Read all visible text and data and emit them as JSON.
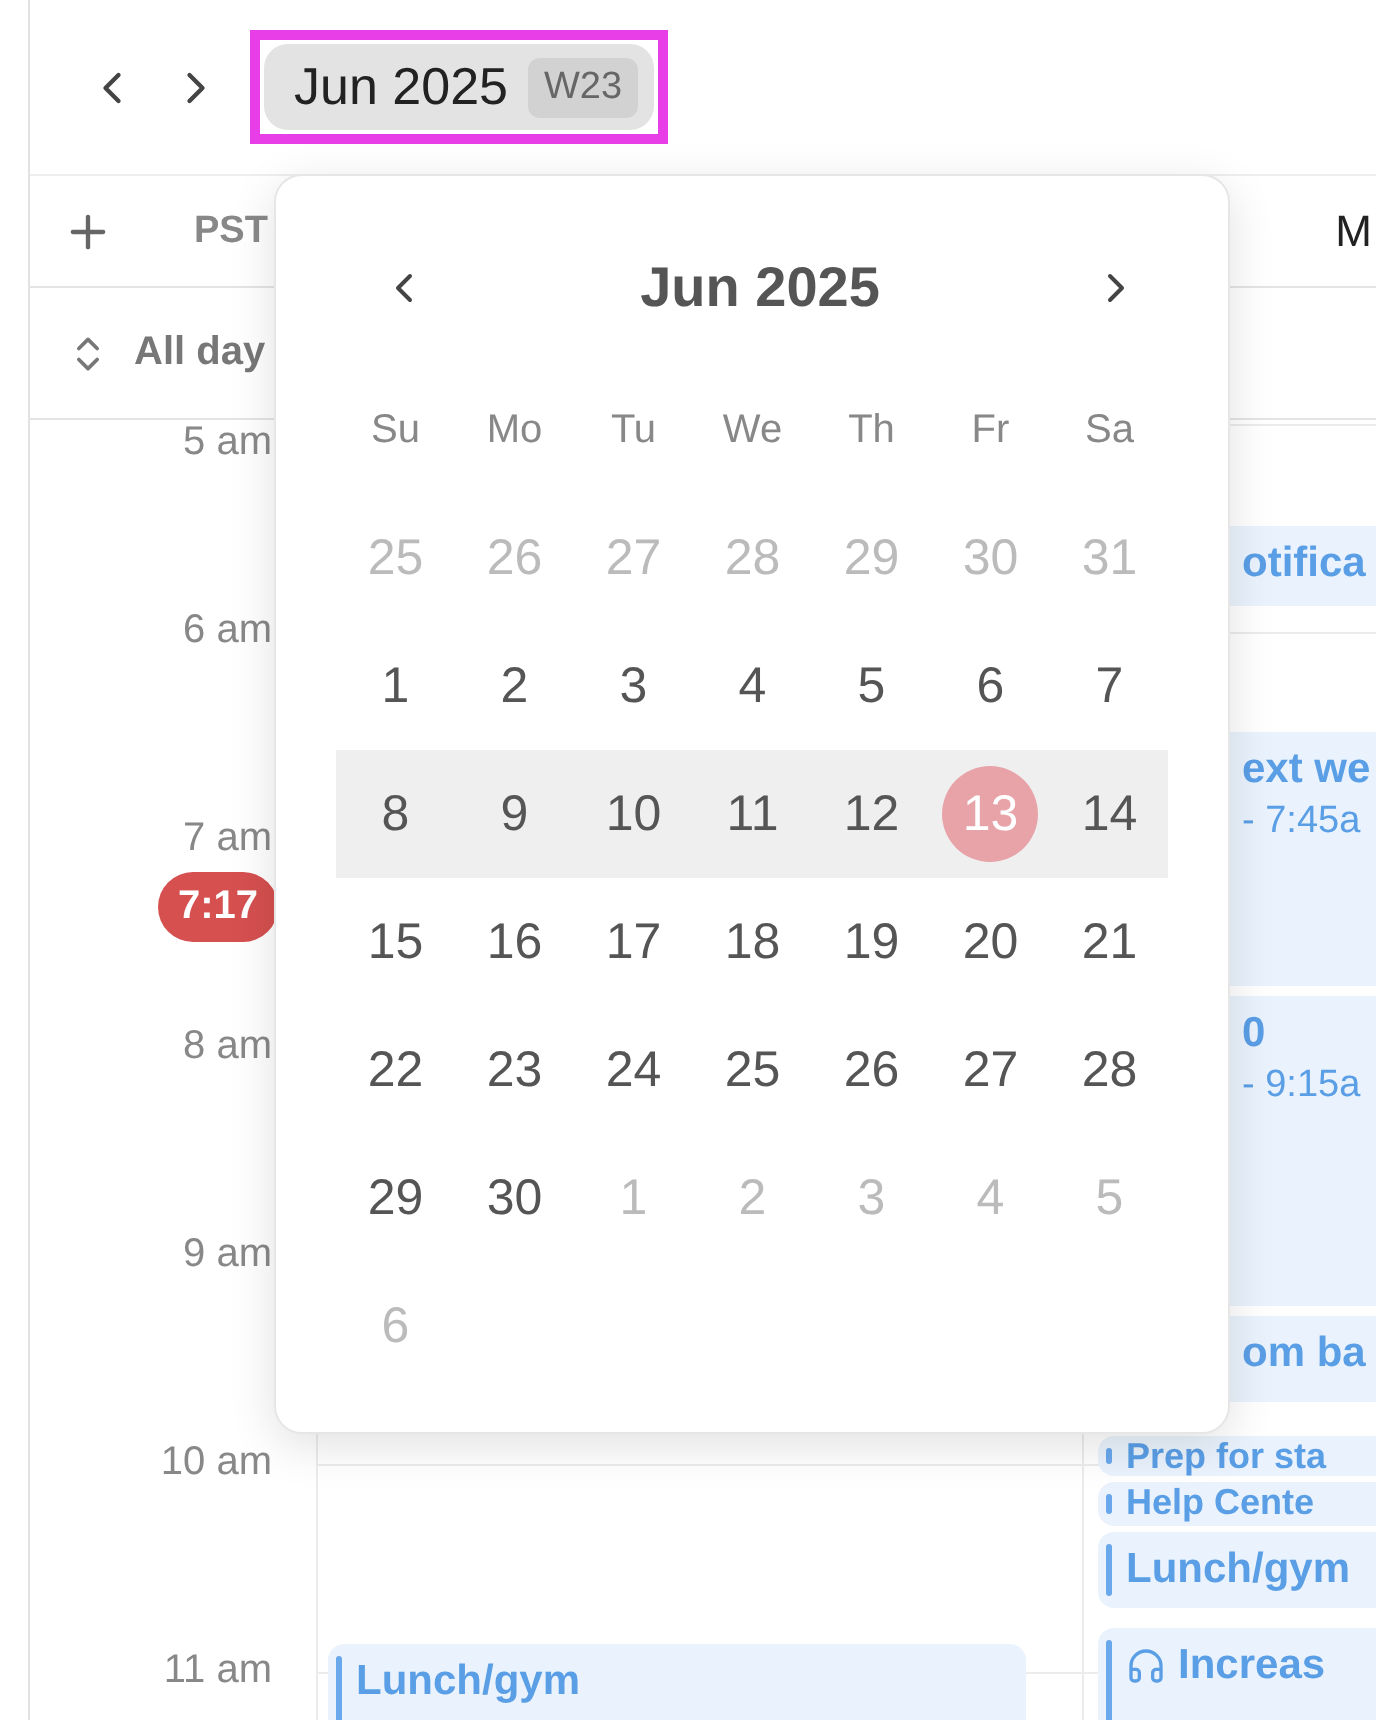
{
  "toolbar": {
    "month_button": {
      "label": "Jun 2025",
      "week_badge": "W23",
      "highlighted": true
    }
  },
  "header": {
    "timezone": "PST",
    "day_label": "M",
    "all_day": "All day"
  },
  "hours": [
    "5 am",
    "6 am",
    "7 am",
    "8 am",
    "9 am",
    "10 am",
    "11 am"
  ],
  "now_badge": "7:17",
  "events": [
    {
      "lines": [
        "Lunch/gym"
      ],
      "kind": "plain"
    },
    {
      "lines": [
        "otifica"
      ],
      "kind": "plain"
    },
    {
      "lines": [
        "ext we",
        "- 7:45a"
      ],
      "kind": "plain"
    },
    {
      "lines": [
        "0",
        "- 9:15a"
      ],
      "kind": "plain"
    },
    {
      "lines": [
        "om ba"
      ],
      "kind": "plain"
    },
    {
      "lines": [
        "Prep for sta"
      ],
      "kind": "small"
    },
    {
      "lines": [
        "Help Cente"
      ],
      "kind": "small"
    },
    {
      "lines": [
        "Lunch/gym"
      ],
      "kind": "plain"
    },
    {
      "lines": [
        "Increas"
      ],
      "kind": "headphones"
    }
  ],
  "date_picker": {
    "title": "Jun 2025",
    "weekdays": [
      "Su",
      "Mo",
      "Tu",
      "We",
      "Th",
      "Fr",
      "Sa"
    ],
    "weeks": [
      {
        "selected": false,
        "days": [
          {
            "label": "25",
            "muted": true,
            "today": false
          },
          {
            "label": "26",
            "muted": true,
            "today": false
          },
          {
            "label": "27",
            "muted": true,
            "today": false
          },
          {
            "label": "28",
            "muted": true,
            "today": false
          },
          {
            "label": "29",
            "muted": true,
            "today": false
          },
          {
            "label": "30",
            "muted": true,
            "today": false
          },
          {
            "label": "31",
            "muted": true,
            "today": false
          }
        ]
      },
      {
        "selected": false,
        "days": [
          {
            "label": "1",
            "muted": false,
            "today": false
          },
          {
            "label": "2",
            "muted": false,
            "today": false
          },
          {
            "label": "3",
            "muted": false,
            "today": false
          },
          {
            "label": "4",
            "muted": false,
            "today": false
          },
          {
            "label": "5",
            "muted": false,
            "today": false
          },
          {
            "label": "6",
            "muted": false,
            "today": false
          },
          {
            "label": "7",
            "muted": false,
            "today": false
          }
        ]
      },
      {
        "selected": true,
        "days": [
          {
            "label": "8",
            "muted": false,
            "today": false
          },
          {
            "label": "9",
            "muted": false,
            "today": false
          },
          {
            "label": "10",
            "muted": false,
            "today": false
          },
          {
            "label": "11",
            "muted": false,
            "today": false
          },
          {
            "label": "12",
            "muted": false,
            "today": false
          },
          {
            "label": "13",
            "muted": false,
            "today": true
          },
          {
            "label": "14",
            "muted": false,
            "today": false
          }
        ]
      },
      {
        "selected": false,
        "days": [
          {
            "label": "15",
            "muted": false,
            "today": false
          },
          {
            "label": "16",
            "muted": false,
            "today": false
          },
          {
            "label": "17",
            "muted": false,
            "today": false
          },
          {
            "label": "18",
            "muted": false,
            "today": false
          },
          {
            "label": "19",
            "muted": false,
            "today": false
          },
          {
            "label": "20",
            "muted": false,
            "today": false
          },
          {
            "label": "21",
            "muted": false,
            "today": false
          }
        ]
      },
      {
        "selected": false,
        "days": [
          {
            "label": "22",
            "muted": false,
            "today": false
          },
          {
            "label": "23",
            "muted": false,
            "today": false
          },
          {
            "label": "24",
            "muted": false,
            "today": false
          },
          {
            "label": "25",
            "muted": false,
            "today": false
          },
          {
            "label": "26",
            "muted": false,
            "today": false
          },
          {
            "label": "27",
            "muted": false,
            "today": false
          },
          {
            "label": "28",
            "muted": false,
            "today": false
          }
        ]
      },
      {
        "selected": false,
        "days": [
          {
            "label": "29",
            "muted": false,
            "today": false
          },
          {
            "label": "30",
            "muted": false,
            "today": false
          },
          {
            "label": "1",
            "muted": true,
            "today": false
          },
          {
            "label": "2",
            "muted": true,
            "today": false
          },
          {
            "label": "3",
            "muted": true,
            "today": false
          },
          {
            "label": "4",
            "muted": true,
            "today": false
          },
          {
            "label": "5",
            "muted": true,
            "today": false
          }
        ]
      },
      {
        "selected": false,
        "days": [
          {
            "label": "6",
            "muted": true,
            "today": false
          }
        ]
      }
    ]
  }
}
